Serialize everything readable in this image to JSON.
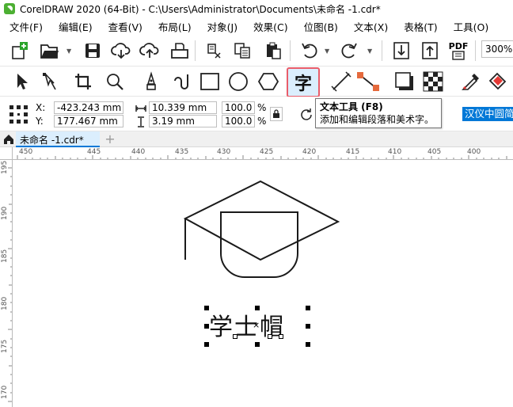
{
  "window": {
    "title": "CorelDRAW 2020 (64-Bit) - C:\\Users\\Administrator\\Documents\\未命名 -1.cdr*"
  },
  "menu": [
    "文件(F)",
    "编辑(E)",
    "查看(V)",
    "布局(L)",
    "对象(J)",
    "效果(C)",
    "位图(B)",
    "文本(X)",
    "表格(T)",
    "工具(O)"
  ],
  "toolbar": {
    "zoom": "300%",
    "pdf_label": "PDF"
  },
  "tools": {
    "text_tool_glyph": "字"
  },
  "tooltip": {
    "title": "文本工具 (F8)",
    "description": "添加和编辑段落和美术字。"
  },
  "property_bar": {
    "x_label": "X:",
    "y_label": "Y:",
    "x_value": "-423.243 mm",
    "y_value": "177.467 mm",
    "width_value": "10.339 mm",
    "height_value": "3.19 mm",
    "scale_x": "100.0",
    "scale_y": "100.0",
    "percent": "%",
    "font_name": "汉仪中圆简"
  },
  "tabs": {
    "doc_tab_label": "未命名 -1.cdr*",
    "add_tab": "+"
  },
  "ruler": {
    "horizontal": [
      "450",
      "445",
      "440",
      "435",
      "430",
      "425",
      "420",
      "415",
      "410",
      "405",
      "400"
    ],
    "vertical": [
      "195",
      "190",
      "185",
      "180",
      "175",
      "170"
    ]
  },
  "canvas": {
    "text_object": "学士帽"
  },
  "colors": {
    "accent": "#0078d7",
    "active_tool_border": "#e95d6a",
    "active_tool_bg": "#dbeefd"
  }
}
